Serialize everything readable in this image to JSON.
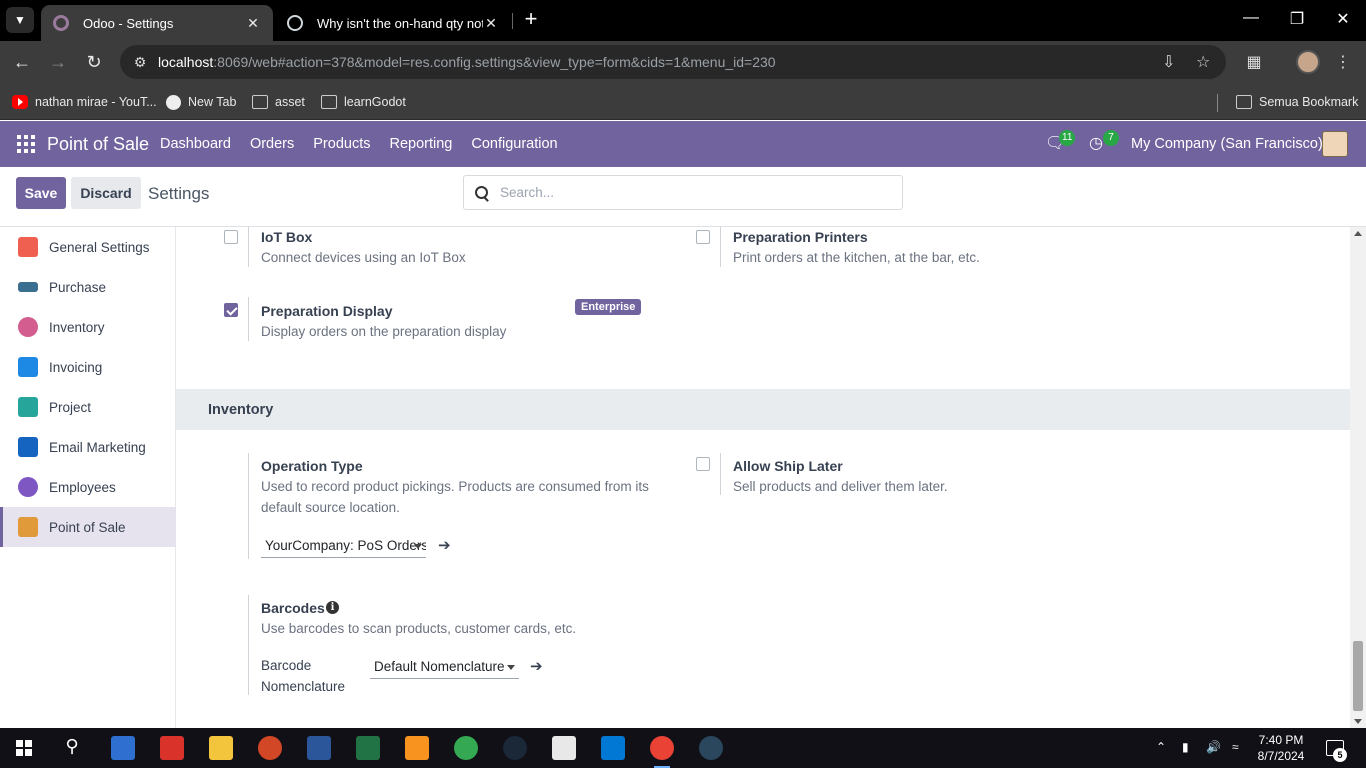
{
  "browser": {
    "tabs": [
      {
        "title": "Odoo - Settings",
        "active": true
      },
      {
        "title": "Why isn't the on-hand qty not u",
        "active": false
      }
    ],
    "url_host": "localhost",
    "url_rest": ":8069/web#action=378&model=res.config.settings&view_type=form&cids=1&menu_id=230",
    "bookmarks": [
      "nathan mirae - YouT...",
      "New Tab",
      "asset",
      "learnGodot"
    ],
    "other_bookmarks": "Semua Bookmark"
  },
  "navbar": {
    "app_name": "Point of Sale",
    "menu": [
      "Dashboard",
      "Orders",
      "Products",
      "Reporting",
      "Configuration"
    ],
    "messages_count": "11",
    "activities_count": "7",
    "company": "My Company (San Francisco)"
  },
  "control": {
    "save_label": "Save",
    "discard_label": "Discard",
    "breadcrumb": "Settings",
    "search_placeholder": "Search..."
  },
  "sidebar": {
    "items": [
      {
        "label": "General Settings",
        "color": "#f06050"
      },
      {
        "label": "Purchase",
        "color": "#3a6f8f"
      },
      {
        "label": "Inventory",
        "color": "#d35d8e"
      },
      {
        "label": "Invoicing",
        "color": "#1e88e5"
      },
      {
        "label": "Project",
        "color": "#26a69a"
      },
      {
        "label": "Email Marketing",
        "color": "#1565c0"
      },
      {
        "label": "Employees",
        "color": "#7e57c2"
      },
      {
        "label": "Point of Sale",
        "color": "#e09a3a",
        "active": true
      }
    ]
  },
  "settings": {
    "iot_box": {
      "title": "IoT Box",
      "desc": "Connect devices using an IoT Box",
      "checked": false
    },
    "prep_printers": {
      "title": "Preparation Printers",
      "desc": "Print orders at the kitchen, at the bar, etc.",
      "checked": false
    },
    "prep_display": {
      "title": "Preparation Display",
      "desc": "Display orders on the preparation display",
      "checked": true,
      "badge": "Enterprise"
    },
    "inventory_section": "Inventory",
    "operation_type": {
      "title": "Operation Type",
      "desc": "Used to record product pickings. Products are consumed from its default source location.",
      "value": "YourCompany: PoS Orders"
    },
    "allow_ship_later": {
      "title": "Allow Ship Later",
      "desc": "Sell products and deliver them later.",
      "checked": false
    },
    "barcodes": {
      "title": "Barcodes",
      "desc": "Use barcodes to scan products, customer cards, etc.",
      "label": "Barcode Nomenclature",
      "value": "Default Nomenclature"
    }
  },
  "taskbar": {
    "time": "7:40 PM",
    "date": "8/7/2024",
    "notifications": "5"
  }
}
